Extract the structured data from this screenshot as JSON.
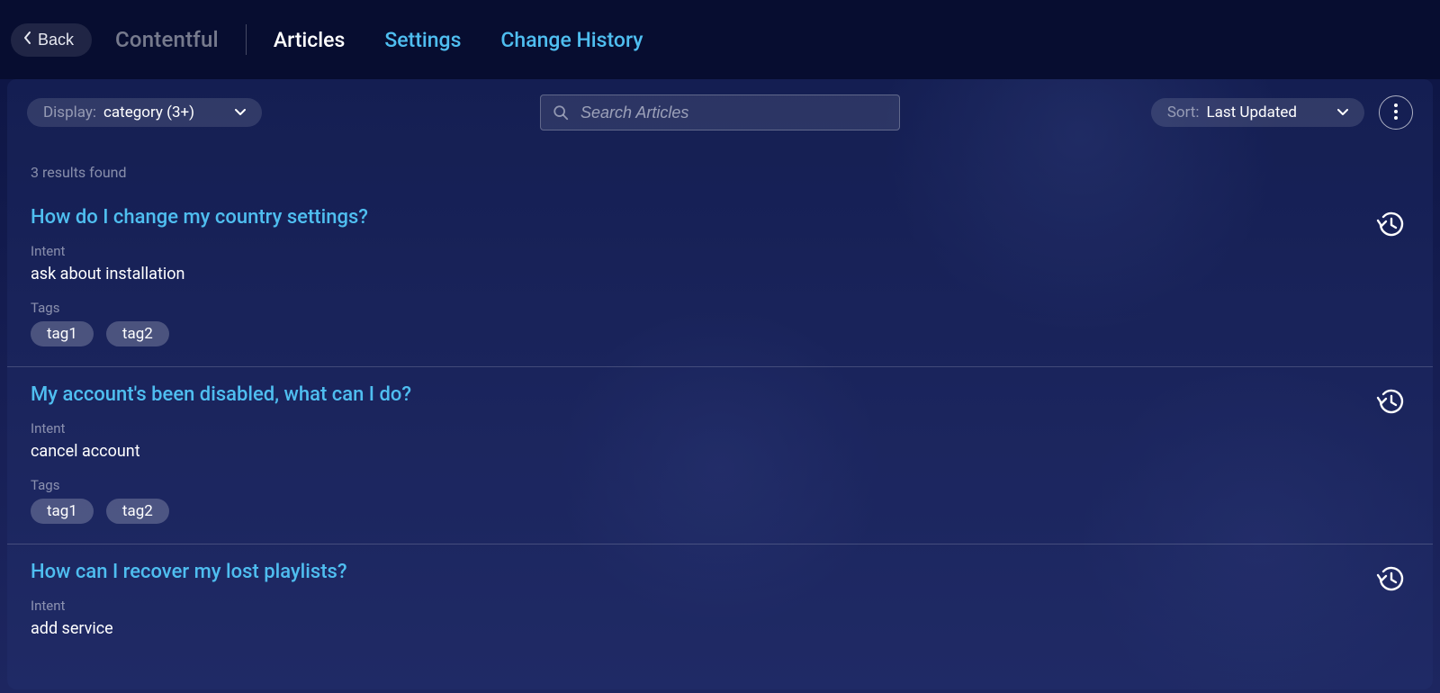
{
  "header": {
    "back_label": "Back",
    "app_name": "Contentful",
    "tabs": [
      {
        "label": "Articles",
        "active": true
      },
      {
        "label": "Settings",
        "active": false
      },
      {
        "label": "Change History",
        "active": false
      }
    ]
  },
  "toolbar": {
    "display_label": "Display:",
    "display_value": "category (3+)",
    "search_placeholder": "Search Articles",
    "sort_label": "Sort:",
    "sort_value": "Last Updated"
  },
  "results": {
    "count_text": "3 results found",
    "intent_label": "Intent",
    "tags_label": "Tags",
    "items": [
      {
        "title": "How do I change my country settings?",
        "intent": "ask about installation",
        "tags": [
          "tag1",
          "tag2"
        ]
      },
      {
        "title": "My account's been disabled, what can I do?",
        "intent": "cancel account",
        "tags": [
          "tag1",
          "tag2"
        ]
      },
      {
        "title": "How can I recover my lost playlists?",
        "intent": "add service",
        "tags": []
      }
    ]
  }
}
